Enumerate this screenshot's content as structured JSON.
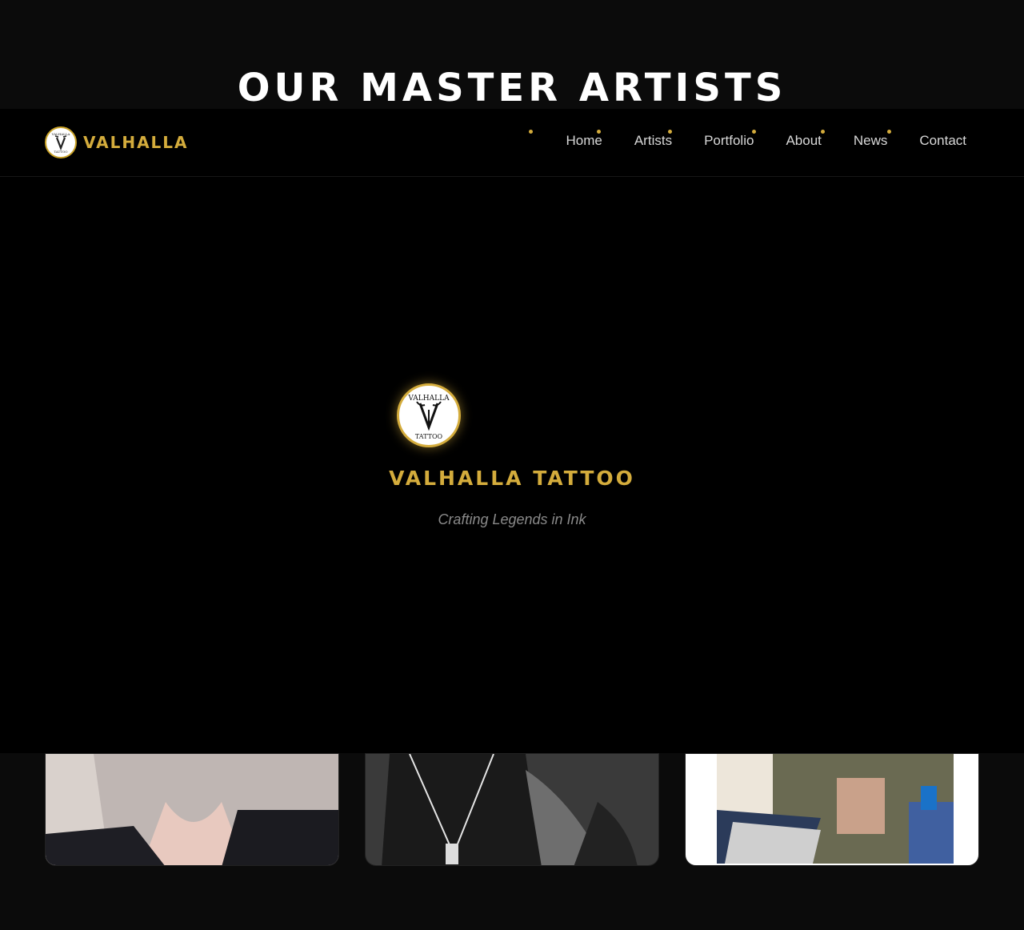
{
  "section": {
    "title": "OUR MASTER ARTISTS"
  },
  "navbar": {
    "brand": "VALHALLA",
    "links": [
      "Home",
      "Artists",
      "Portfolio",
      "About",
      "News",
      "Contact"
    ]
  },
  "splash": {
    "logo_text_top": "VALHALLA",
    "logo_text_bottom": "TATTOO",
    "title": "VALHALLA TATTOO",
    "tagline": "Crafting Legends in Ink"
  },
  "colors": {
    "accent": "#d4ac3c",
    "background": "#000000",
    "text": "#d8d8d8"
  },
  "icons": [
    "valhalla-logo-icon",
    "axes-icon"
  ]
}
